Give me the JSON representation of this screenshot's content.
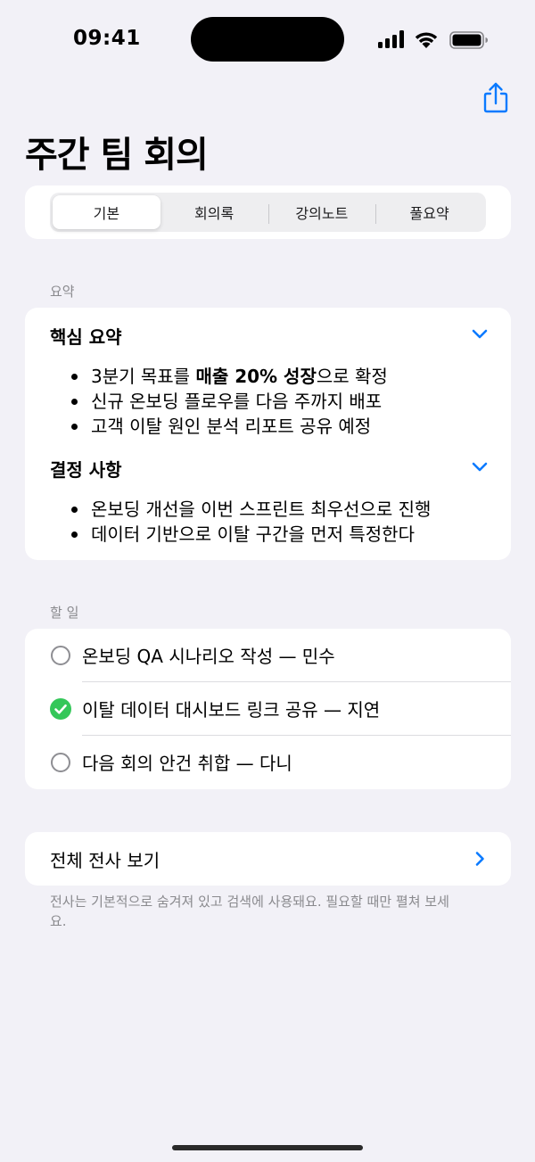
{
  "status": {
    "time": "09:41",
    "signal_icon": "cellular-signal-icon",
    "wifi_icon": "wifi-icon",
    "battery_icon": "battery-icon"
  },
  "nav": {
    "share_icon": "share-icon",
    "title": "주간 팀 회의"
  },
  "tabs": [
    {
      "label": "기본",
      "active": true
    },
    {
      "label": "회의록",
      "active": false
    },
    {
      "label": "강의노트",
      "active": false
    },
    {
      "label": "풀요약",
      "active": false
    }
  ],
  "summary": {
    "section_label": "요약",
    "groups": [
      {
        "title": "핵심 요약",
        "items": [
          {
            "pre": "3분기 목표를 ",
            "bold": "매출 20% 성장",
            "post": "으로 확정"
          },
          {
            "pre": "신규 온보딩 플로우를 다음 주까지 배포",
            "bold": "",
            "post": ""
          },
          {
            "pre": "고객 이탈 원인 분석 리포트 공유 예정",
            "bold": "",
            "post": ""
          }
        ]
      },
      {
        "title": "결정 사항",
        "items": [
          {
            "pre": "온보딩 개선을 이번 스프린트 최우선으로 진행",
            "bold": "",
            "post": ""
          },
          {
            "pre": "데이터 기반으로 이탈 구간을 먼저 특정한다",
            "bold": "",
            "post": ""
          }
        ]
      }
    ]
  },
  "todos": {
    "section_label": "할 일",
    "items": [
      {
        "text": "온보딩 QA 시나리오 작성 — 민수",
        "done": false
      },
      {
        "text": "이탈 데이터 대시보드 링크 공유 — 지연",
        "done": true
      },
      {
        "text": "다음 회의 안건 취합 — 다니",
        "done": false
      }
    ]
  },
  "transcript": {
    "label": "전체 전사 보기",
    "footnote": "전사는 기본적으로 숨겨져 있고 검색에 사용돼요. 필요할 때만 펼쳐 보세요."
  },
  "colors": {
    "accent": "#0a7aff",
    "check": "#34c759",
    "background": "#f2f1f7"
  }
}
